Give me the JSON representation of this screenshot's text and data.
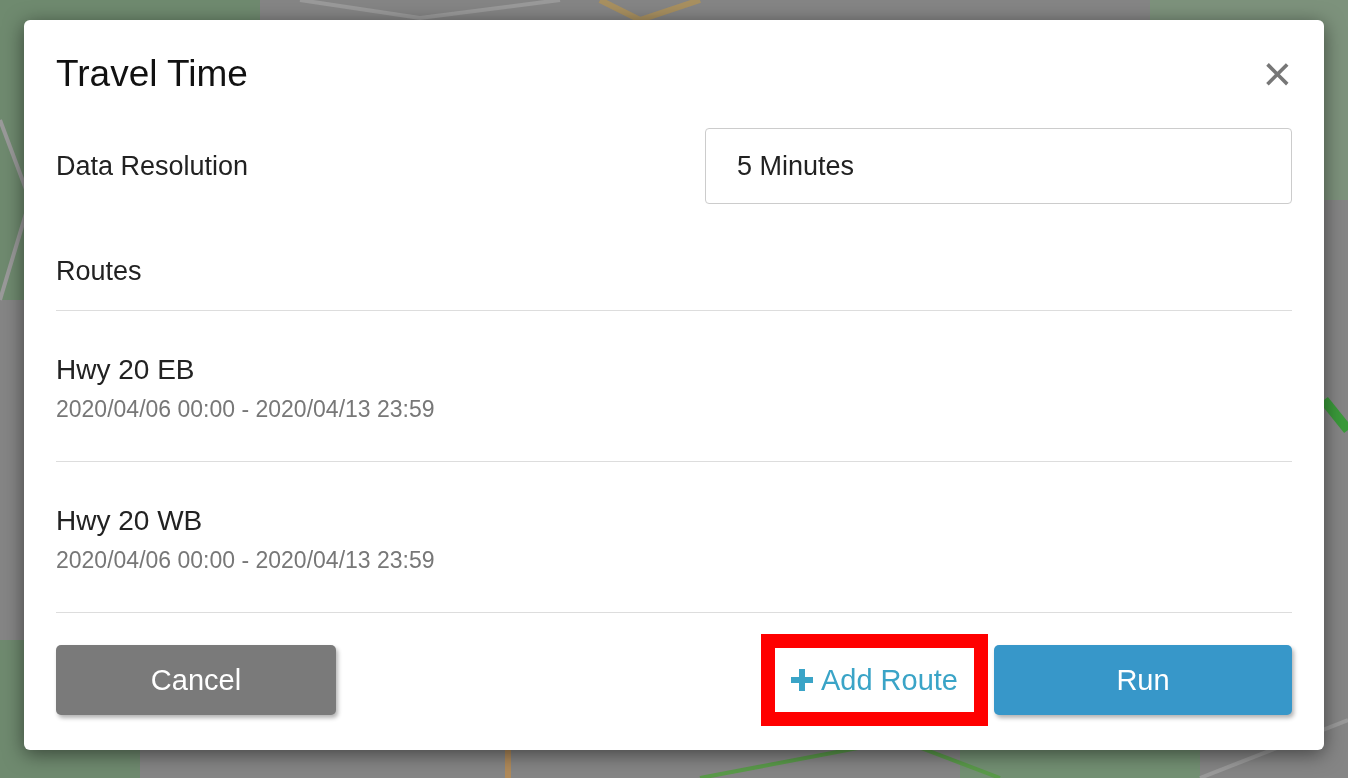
{
  "dialog": {
    "title": "Travel Time",
    "close": "×"
  },
  "resolution": {
    "label": "Data Resolution",
    "value": "5 Minutes"
  },
  "routes": {
    "label": "Routes",
    "items": [
      {
        "name": "Hwy 20 EB",
        "range": "2020/04/06 00:00 - 2020/04/13 23:59"
      },
      {
        "name": "Hwy 20 WB",
        "range": "2020/04/06 00:00 - 2020/04/13 23:59"
      }
    ]
  },
  "buttons": [
    {
      "kind": "secondary",
      "label": "Cancel",
      "highlighted": false
    },
    {
      "kind": "link",
      "label": "Add Route",
      "highlighted": true
    },
    {
      "kind": "primary",
      "label": "Run",
      "highlighted": false
    }
  ]
}
